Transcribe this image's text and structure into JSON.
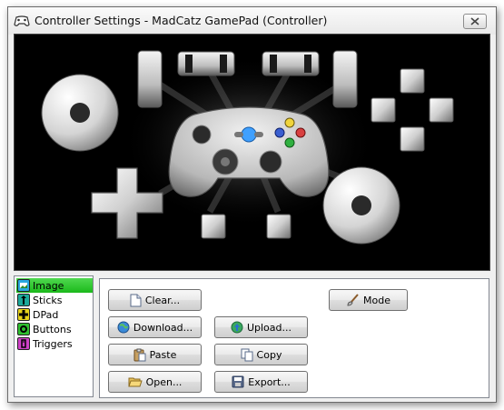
{
  "window": {
    "title": "Controller Settings - MadCatz GamePad (Controller)"
  },
  "sidebar": {
    "items": [
      {
        "label": "Image",
        "icon": "image-icon",
        "color": "#2aa7e0"
      },
      {
        "label": "Sticks",
        "icon": "sticks-icon",
        "color": "#1aa89a"
      },
      {
        "label": "DPad",
        "icon": "dpad-icon",
        "color": "#e6d21a"
      },
      {
        "label": "Buttons",
        "icon": "buttons-icon",
        "color": "#2fbf2f"
      },
      {
        "label": "Triggers",
        "icon": "triggers-icon",
        "color": "#d040c8"
      }
    ],
    "selected_color": "#22bf22"
  },
  "buttons": {
    "clear": "Clear...",
    "download": "Download...",
    "upload": "Upload...",
    "paste": "Paste",
    "copy": "Copy",
    "open": "Open...",
    "export": "Export...",
    "mode": "Mode"
  },
  "controller": {
    "face_buttons": [
      "#f0d43c",
      "#d84040",
      "#3a5fd0",
      "#30b040"
    ],
    "guide_color": "#3fa0ff"
  }
}
